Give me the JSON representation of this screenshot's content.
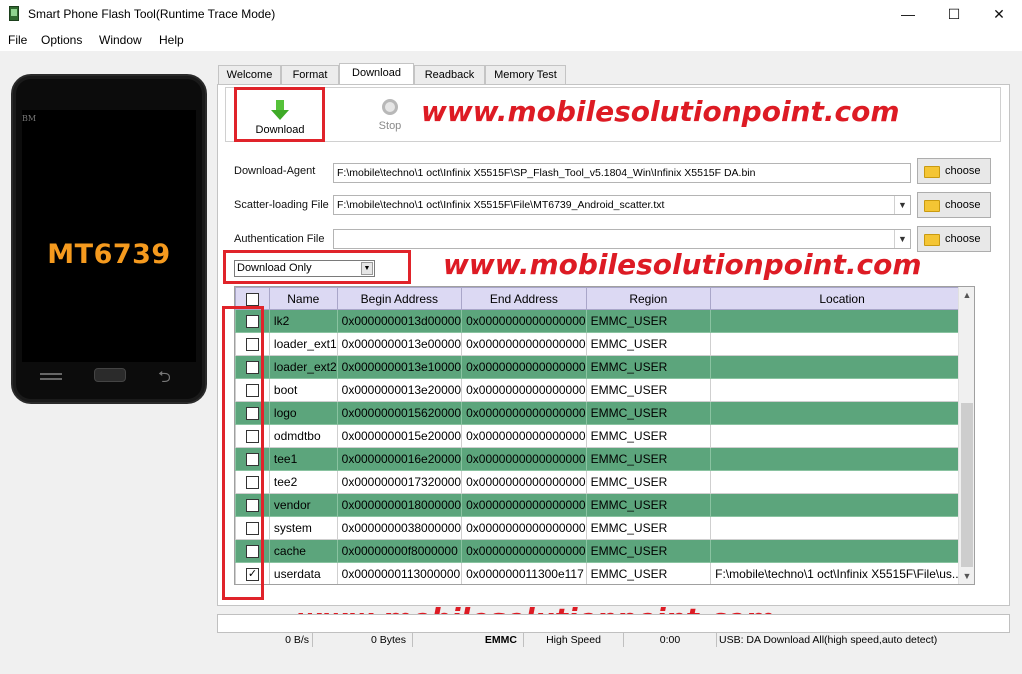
{
  "window": {
    "title": "Smart Phone Flash Tool(Runtime Trace Mode)",
    "minimize": "—",
    "maximize": "☐",
    "close": "✕"
  },
  "menu": [
    "File",
    "Options",
    "Window",
    "Help"
  ],
  "phone": {
    "brand": "BM",
    "model": "MT6739"
  },
  "tabs": [
    "Welcome",
    "Format",
    "Download",
    "Readback",
    "Memory Test"
  ],
  "active_tab": "Download",
  "toolbar": {
    "download_label": "Download",
    "stop_label": "Stop"
  },
  "watermark": "www.mobilesolutionpoint.com",
  "form": {
    "download_agent_label": "Download-Agent",
    "download_agent_value": "F:\\mobile\\techno\\1 oct\\Infinix X5515F\\SP_Flash_Tool_v5.1804_Win\\Infinix X5515F DA.bin",
    "scatter_label": "Scatter-loading File",
    "scatter_value": "F:\\mobile\\techno\\1 oct\\Infinix X5515F\\File\\MT6739_Android_scatter.txt",
    "auth_label": "Authentication File",
    "auth_value": "",
    "choose_label": "choose"
  },
  "mode": "Download Only",
  "table": {
    "columns": [
      "",
      "Name",
      "Begin Address",
      "End Address",
      "Region",
      "Location"
    ],
    "rows": [
      {
        "checked": false,
        "name": "lk2",
        "begin": "0x0000000013d00000",
        "end": "0x0000000000000000",
        "region": "EMMC_USER",
        "location": ""
      },
      {
        "checked": false,
        "name": "loader_ext1",
        "begin": "0x0000000013e00000",
        "end": "0x0000000000000000",
        "region": "EMMC_USER",
        "location": ""
      },
      {
        "checked": false,
        "name": "loader_ext2",
        "begin": "0x0000000013e10000",
        "end": "0x0000000000000000",
        "region": "EMMC_USER",
        "location": ""
      },
      {
        "checked": false,
        "name": "boot",
        "begin": "0x0000000013e20000",
        "end": "0x0000000000000000",
        "region": "EMMC_USER",
        "location": ""
      },
      {
        "checked": false,
        "name": "logo",
        "begin": "0x0000000015620000",
        "end": "0x0000000000000000",
        "region": "EMMC_USER",
        "location": ""
      },
      {
        "checked": false,
        "name": "odmdtbo",
        "begin": "0x0000000015e20000",
        "end": "0x0000000000000000",
        "region": "EMMC_USER",
        "location": ""
      },
      {
        "checked": false,
        "name": "tee1",
        "begin": "0x0000000016e20000",
        "end": "0x0000000000000000",
        "region": "EMMC_USER",
        "location": ""
      },
      {
        "checked": false,
        "name": "tee2",
        "begin": "0x0000000017320000",
        "end": "0x0000000000000000",
        "region": "EMMC_USER",
        "location": ""
      },
      {
        "checked": false,
        "name": "vendor",
        "begin": "0x0000000018000000",
        "end": "0x0000000000000000",
        "region": "EMMC_USER",
        "location": ""
      },
      {
        "checked": false,
        "name": "system",
        "begin": "0x0000000038000000",
        "end": "0x0000000000000000",
        "region": "EMMC_USER",
        "location": ""
      },
      {
        "checked": false,
        "name": "cache",
        "begin": "0x00000000f8000000",
        "end": "0x0000000000000000",
        "region": "EMMC_USER",
        "location": ""
      },
      {
        "checked": true,
        "name": "userdata",
        "begin": "0x0000000113000000",
        "end": "0x000000011300e117",
        "region": "EMMC_USER",
        "location": "F:\\mobile\\techno\\1 oct\\Infinix X5515F\\File\\us..."
      }
    ]
  },
  "status": {
    "speed": "0 B/s",
    "bytes": "0 Bytes",
    "storage": "EMMC",
    "mode": "High Speed",
    "time": "0:00",
    "usb": "USB: DA Download All(high speed,auto detect)"
  },
  "colors": {
    "watermark": "#dd1b24",
    "green_row": "#5ca57c",
    "header": "#dcd9f3",
    "highlight_box": "#e0232a"
  },
  "icons": [
    "download-arrow-icon",
    "stop-icon",
    "folder-icon",
    "checkbox-icon",
    "chevron-down-icon"
  ]
}
